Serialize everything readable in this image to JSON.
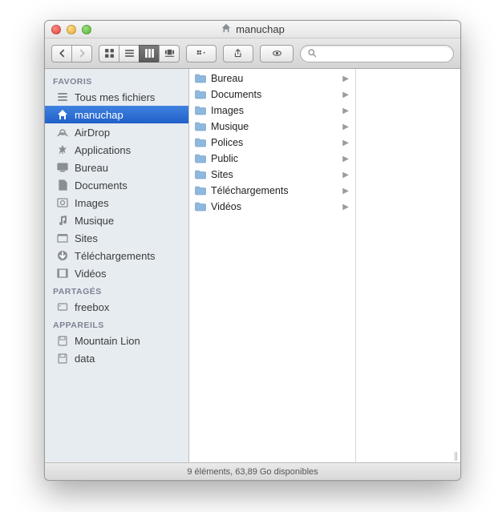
{
  "window": {
    "title": "manuchap"
  },
  "search": {
    "placeholder": ""
  },
  "sidebar": {
    "sections": [
      {
        "title": "FAVORIS",
        "items": [
          {
            "label": "Tous mes fichiers",
            "icon": "all-my-files-icon",
            "selected": false
          },
          {
            "label": "manuchap",
            "icon": "home-icon",
            "selected": true
          },
          {
            "label": "AirDrop",
            "icon": "airdrop-icon",
            "selected": false
          },
          {
            "label": "Applications",
            "icon": "applications-icon",
            "selected": false
          },
          {
            "label": "Bureau",
            "icon": "desktop-icon",
            "selected": false
          },
          {
            "label": "Documents",
            "icon": "documents-icon",
            "selected": false
          },
          {
            "label": "Images",
            "icon": "pictures-icon",
            "selected": false
          },
          {
            "label": "Musique",
            "icon": "music-icon",
            "selected": false
          },
          {
            "label": "Sites",
            "icon": "sites-icon",
            "selected": false
          },
          {
            "label": "Téléchargements",
            "icon": "downloads-icon",
            "selected": false
          },
          {
            "label": "Vidéos",
            "icon": "movies-icon",
            "selected": false
          }
        ]
      },
      {
        "title": "PARTAGÉS",
        "items": [
          {
            "label": "freebox",
            "icon": "server-icon",
            "selected": false
          }
        ]
      },
      {
        "title": "APPAREILS",
        "items": [
          {
            "label": "Mountain Lion",
            "icon": "disk-icon",
            "selected": false
          },
          {
            "label": "data",
            "icon": "disk-icon",
            "selected": false
          }
        ]
      }
    ]
  },
  "content": {
    "column": [
      {
        "label": "Bureau",
        "has_children": true
      },
      {
        "label": "Documents",
        "has_children": true
      },
      {
        "label": "Images",
        "has_children": true
      },
      {
        "label": "Musique",
        "has_children": true
      },
      {
        "label": "Polices",
        "has_children": true
      },
      {
        "label": "Public",
        "has_children": true
      },
      {
        "label": "Sites",
        "has_children": true
      },
      {
        "label": "Téléchargements",
        "has_children": true
      },
      {
        "label": "Vidéos",
        "has_children": true
      }
    ]
  },
  "status": {
    "text": "9 éléments, 63,89 Go disponibles"
  }
}
